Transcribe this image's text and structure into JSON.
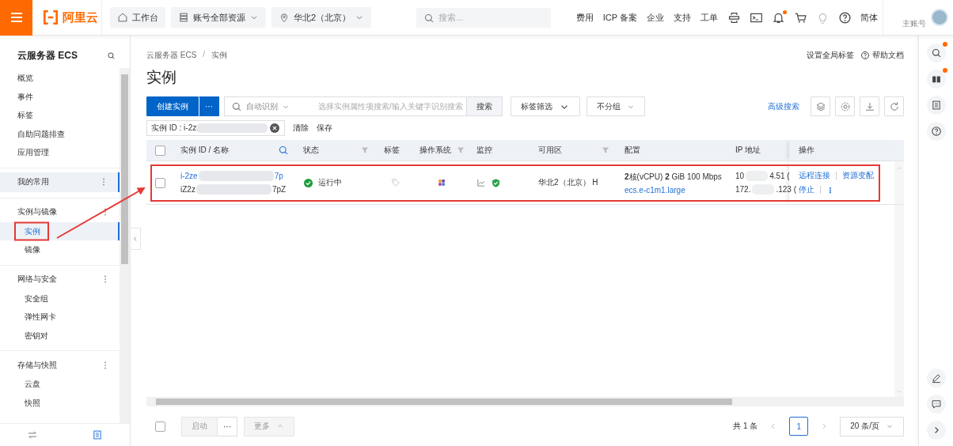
{
  "top_bar": {
    "logo": "阿里云",
    "pills": [
      {
        "label": "工作台",
        "dropdown": false
      },
      {
        "label": "账号全部资源",
        "dropdown": true
      },
      {
        "label": "华北2（北京）",
        "dropdown": true
      }
    ],
    "search": {
      "placeholder": "搜索..."
    },
    "links": [
      "费用",
      "ICP 备案",
      "企业",
      "支持",
      "工单"
    ],
    "icons": [
      {
        "dot": false
      },
      {
        "dot": false
      },
      {
        "dot": true
      },
      {
        "dot": false
      },
      {
        "dot": false
      },
      {
        "dot": false
      }
    ],
    "language": "简体",
    "account": "主账号"
  },
  "sidebar": {
    "title": "云服务器 ECS",
    "items": [
      {
        "label": "概览",
        "selected": false
      },
      {
        "label": "事件",
        "selected": false
      },
      {
        "label": "标签",
        "selected": false
      },
      {
        "label": "自助问题排查",
        "selected": false
      },
      {
        "label": "应用管理",
        "selected": false
      }
    ],
    "groups": [
      {
        "label": "我的常用",
        "selected": true
      },
      {
        "label": "实例与镜像",
        "selected": false,
        "children": [
          {
            "label": "实例",
            "selected": true
          },
          {
            "label": "镜像",
            "selected": false
          }
        ]
      },
      {
        "label": "网络与安全",
        "selected": false,
        "children": [
          {
            "label": "安全组",
            "selected": false
          },
          {
            "label": "弹性网卡",
            "selected": false
          },
          {
            "label": "密钥对",
            "selected": false
          }
        ]
      },
      {
        "label": "存储与快照",
        "selected": false,
        "children": [
          {
            "label": "云盘",
            "selected": false
          },
          {
            "label": "快照",
            "selected": false
          }
        ]
      }
    ]
  },
  "page": {
    "breadcrumb": [
      "云服务器 ECS",
      "实例"
    ],
    "breadcrumb_separator": "/",
    "title": "实例",
    "header_links": [
      "设置全局标签",
      "帮助文档"
    ]
  },
  "toolbar": {
    "create": "创建实例",
    "create_more": "···",
    "search_mode": "自动识别",
    "search_placeholder": "选择实例属性项搜索/输入关键字识别搜索",
    "search_button": "搜索",
    "tag_filter": "标签筛选",
    "group": "不分组",
    "advanced": "高级搜索"
  },
  "filter": {
    "tag": "实例 ID : i-2z",
    "clear": "清除",
    "save": "保存"
  },
  "table": {
    "select_all_checked": false,
    "columns": [
      {
        "label": "实例 ID / 名称",
        "kind": "searchable"
      },
      {
        "label": "状态",
        "kind": "filterable"
      },
      {
        "label": "标签",
        "kind": "plain"
      },
      {
        "label": "操作系统",
        "kind": "filterable"
      },
      {
        "label": "监控",
        "kind": "plain"
      },
      {
        "label": "可用区",
        "kind": "filterable"
      },
      {
        "label": "配置",
        "kind": "plain"
      },
      {
        "label": "IP 地址",
        "kind": "plain"
      },
      {
        "label": "操作",
        "kind": "plain"
      }
    ],
    "rows": [
      {
        "checked": false,
        "id_start": "i-2ze",
        "id_end": "7p",
        "name_start": "iZ2z",
        "name_end": "7pZ",
        "status": "运行中",
        "zone": "华北2（北京） H",
        "config": "**2**核(vCPU)  **2** GiB  100 Mbps",
        "type": "ecs.e-c1m1.large",
        "ip": [
          [
            "10",
            "4.51 ("
          ],
          [
            "172.",
            ".123 ("
          ]
        ],
        "actions": [
          [
            "远程连接",
            "资源变配"
          ],
          [
            "停止"
          ]
        ],
        "more": "⋮"
      }
    ]
  },
  "footer": {
    "select_all_checked": false,
    "start": "启动",
    "more_dots": "···",
    "more": "更多",
    "total": "共 1 条",
    "pages": [
      {
        "label": "1",
        "selected": true
      }
    ],
    "page_size": "20 条/页"
  },
  "rail": {
    "icons": [
      {
        "dot": true
      },
      {
        "dot": true
      },
      {
        "dot": false
      },
      {
        "dot": false
      },
      {
        "dot": false
      },
      {
        "dot": false
      },
      {
        "dot": false
      }
    ]
  }
}
